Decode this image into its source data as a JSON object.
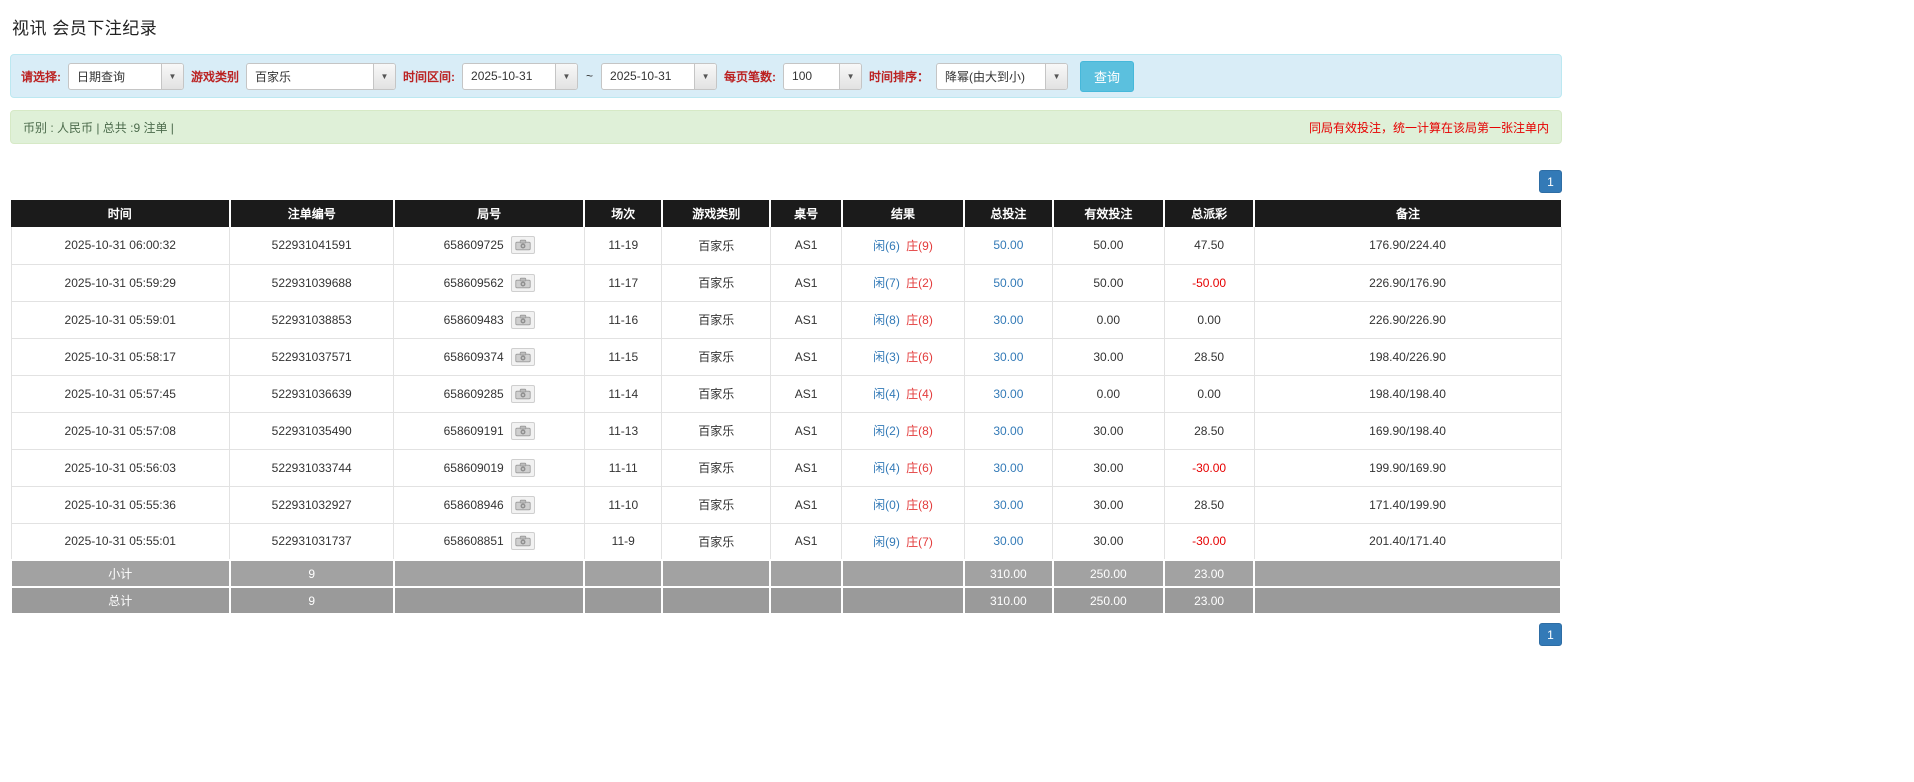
{
  "page": {
    "title": "视讯 会员下注纪录"
  },
  "filters": {
    "select": {
      "label": "请选择:",
      "value": "日期查询"
    },
    "game_type": {
      "label": "游戏类别",
      "value": "百家乐"
    },
    "date_range": {
      "label": "时间区间:",
      "from": "2025-10-31",
      "separator": "~",
      "to": "2025-10-31"
    },
    "per_page": {
      "label": "每页笔数:",
      "value": "100"
    },
    "sort": {
      "label": "时间排序：",
      "value": "降幂(由大到小)"
    },
    "search_button": "查询"
  },
  "info_bar": {
    "summary": "币别 : 人民币 | 总共 :9 注单 |",
    "notice": "同局有效投注，统一计算在该局第一张注单内"
  },
  "pagination": {
    "current_page": "1"
  },
  "table": {
    "headers": [
      "时间",
      "注单编号",
      "局号",
      "场次",
      "游戏类别",
      "桌号",
      "结果",
      "总投注",
      "有效投注",
      "总派彩",
      "备注"
    ],
    "rows": [
      {
        "time": "2025-10-31 06:00:32",
        "bet_id": "522931041591",
        "round": "658609725",
        "session": "11-19",
        "game": "百家乐",
        "table_no": "AS1",
        "result_player": "闲(6)",
        "result_banker": "庄(9)",
        "total_bet": "50.00",
        "valid_bet": "50.00",
        "payout": "47.50",
        "remark": "176.90/224.40"
      },
      {
        "time": "2025-10-31 05:59:29",
        "bet_id": "522931039688",
        "round": "658609562",
        "session": "11-17",
        "game": "百家乐",
        "table_no": "AS1",
        "result_player": "闲(7)",
        "result_banker": "庄(2)",
        "total_bet": "50.00",
        "valid_bet": "50.00",
        "payout": "-50.00",
        "remark": "226.90/176.90"
      },
      {
        "time": "2025-10-31 05:59:01",
        "bet_id": "522931038853",
        "round": "658609483",
        "session": "11-16",
        "game": "百家乐",
        "table_no": "AS1",
        "result_player": "闲(8)",
        "result_banker": "庄(8)",
        "total_bet": "30.00",
        "valid_bet": "0.00",
        "payout": "0.00",
        "remark": "226.90/226.90"
      },
      {
        "time": "2025-10-31 05:58:17",
        "bet_id": "522931037571",
        "round": "658609374",
        "session": "11-15",
        "game": "百家乐",
        "table_no": "AS1",
        "result_player": "闲(3)",
        "result_banker": "庄(6)",
        "total_bet": "30.00",
        "valid_bet": "30.00",
        "payout": "28.50",
        "remark": "198.40/226.90"
      },
      {
        "time": "2025-10-31 05:57:45",
        "bet_id": "522931036639",
        "round": "658609285",
        "session": "11-14",
        "game": "百家乐",
        "table_no": "AS1",
        "result_player": "闲(4)",
        "result_banker": "庄(4)",
        "total_bet": "30.00",
        "valid_bet": "0.00",
        "payout": "0.00",
        "remark": "198.40/198.40"
      },
      {
        "time": "2025-10-31 05:57:08",
        "bet_id": "522931035490",
        "round": "658609191",
        "session": "11-13",
        "game": "百家乐",
        "table_no": "AS1",
        "result_player": "闲(2)",
        "result_banker": "庄(8)",
        "total_bet": "30.00",
        "valid_bet": "30.00",
        "payout": "28.50",
        "remark": "169.90/198.40"
      },
      {
        "time": "2025-10-31 05:56:03",
        "bet_id": "522931033744",
        "round": "658609019",
        "session": "11-11",
        "game": "百家乐",
        "table_no": "AS1",
        "result_player": "闲(4)",
        "result_banker": "庄(6)",
        "total_bet": "30.00",
        "valid_bet": "30.00",
        "payout": "-30.00",
        "remark": "199.90/169.90"
      },
      {
        "time": "2025-10-31 05:55:36",
        "bet_id": "522931032927",
        "round": "658608946",
        "session": "11-10",
        "game": "百家乐",
        "table_no": "AS1",
        "result_player": "闲(0)",
        "result_banker": "庄(8)",
        "total_bet": "30.00",
        "valid_bet": "30.00",
        "payout": "28.50",
        "remark": "171.40/199.90"
      },
      {
        "time": "2025-10-31 05:55:01",
        "bet_id": "522931031737",
        "round": "658608851",
        "session": "11-9",
        "game": "百家乐",
        "table_no": "AS1",
        "result_player": "闲(9)",
        "result_banker": "庄(7)",
        "total_bet": "30.00",
        "valid_bet": "30.00",
        "payout": "-30.00",
        "remark": "201.40/171.40"
      }
    ],
    "subtotal": {
      "label": "小计",
      "count": "9",
      "total_bet": "310.00",
      "valid_bet": "250.00",
      "payout": "23.00"
    },
    "total": {
      "label": "总计",
      "count": "9",
      "total_bet": "310.00",
      "valid_bet": "250.00",
      "payout": "23.00"
    }
  },
  "colors": {
    "accent_blue": "#337ab7",
    "search_button": "#5bc0de",
    "result_player": "#337ab7",
    "result_banker": "#e33b3b",
    "negative": "#e60000"
  }
}
